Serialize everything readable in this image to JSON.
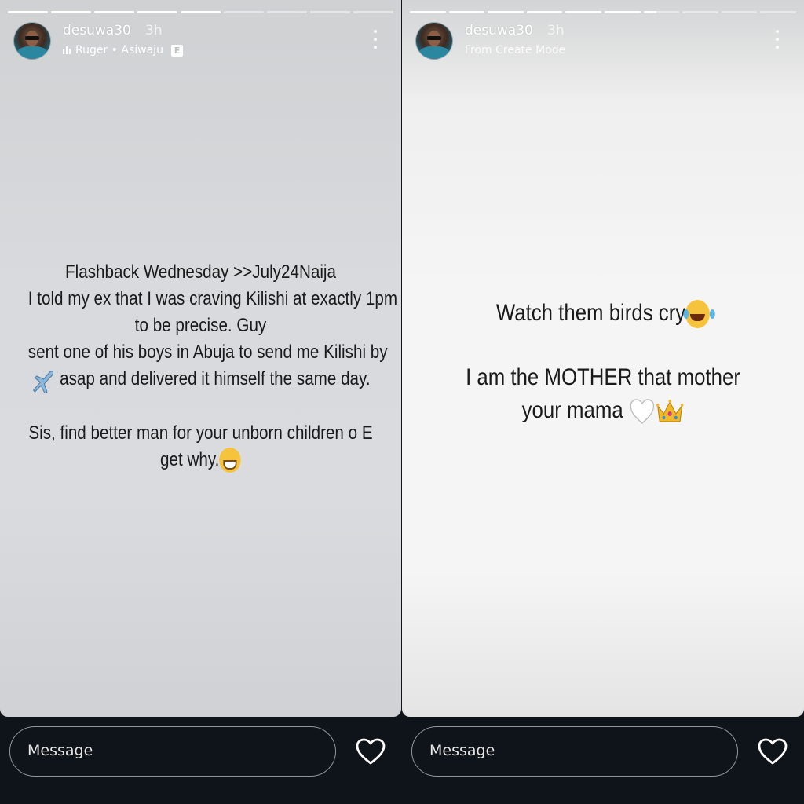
{
  "panels": [
    {
      "username": "desuwa30",
      "time": "3h",
      "subtitle": "Ruger • Asiwaju",
      "explicit_badge": "E",
      "progress": {
        "segments": 9,
        "completed": 5
      },
      "lines": [
        "Flashback Wednesday >>July24Naija",
        "I told my ex that I was craving Kilishi at exactly 1pm",
        "to be precise. Guy",
        "sent one of his boys in Abuja to send me Kilishi by",
        "asap and delivered it himself the same day.",
        "Sis, find  better man for your unborn children o E",
        "get why."
      ],
      "message_placeholder": "Message"
    },
    {
      "username": "desuwa30",
      "time": "3h",
      "subtitle": "From Create Mode",
      "progress": {
        "segments": 10,
        "completed": 6,
        "current_fraction": 0.35
      },
      "lines": [
        "Watch them birds cry",
        "I am the MOTHER that mother",
        "your mama"
      ],
      "message_placeholder": "Message"
    }
  ],
  "icons": {
    "music": "music-bars-icon",
    "more": "more-vertical-icon",
    "like": "heart-outline-icon",
    "plane": "airplane-emoji",
    "grin": "grinning-face-emoji",
    "laugh": "tears-of-joy-emoji",
    "white_heart": "white-heart-emoji",
    "crown": "crown-emoji"
  },
  "colors": {
    "background": "#0f131a",
    "story_left": "#d8dadd",
    "story_right": "#f5f5f5",
    "text": "#1a1a1a"
  }
}
